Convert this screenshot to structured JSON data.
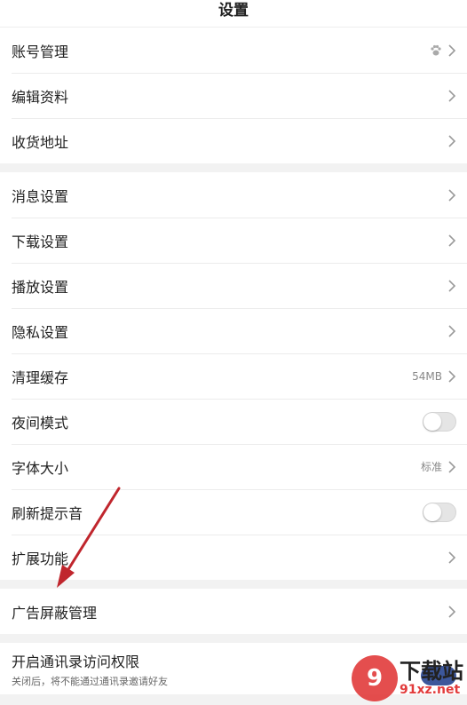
{
  "header": {
    "title": "设置"
  },
  "group1": [
    {
      "label": "账号管理",
      "icon": "paw-icon"
    },
    {
      "label": "编辑资料"
    },
    {
      "label": "收货地址"
    }
  ],
  "group2": [
    {
      "label": "消息设置"
    },
    {
      "label": "下载设置"
    },
    {
      "label": "播放设置"
    },
    {
      "label": "隐私设置"
    },
    {
      "label": "清理缓存",
      "value": "54MB"
    },
    {
      "label": "夜间模式",
      "toggle": false
    },
    {
      "label": "字体大小",
      "value": "标准"
    },
    {
      "label": "刷新提示音",
      "toggle": false
    },
    {
      "label": "扩展功能"
    }
  ],
  "group3": [
    {
      "label": "广告屏蔽管理"
    }
  ],
  "group4": {
    "label": "开启通讯录访问权限",
    "sub": "关闭后，将不能通过通讯录邀请好友"
  },
  "watermark": {
    "logo": "9",
    "cn": "下载站",
    "url": "91xz.net"
  },
  "colors": {
    "arrow": "#c0262d",
    "watermark_red": "#e23b3b"
  }
}
